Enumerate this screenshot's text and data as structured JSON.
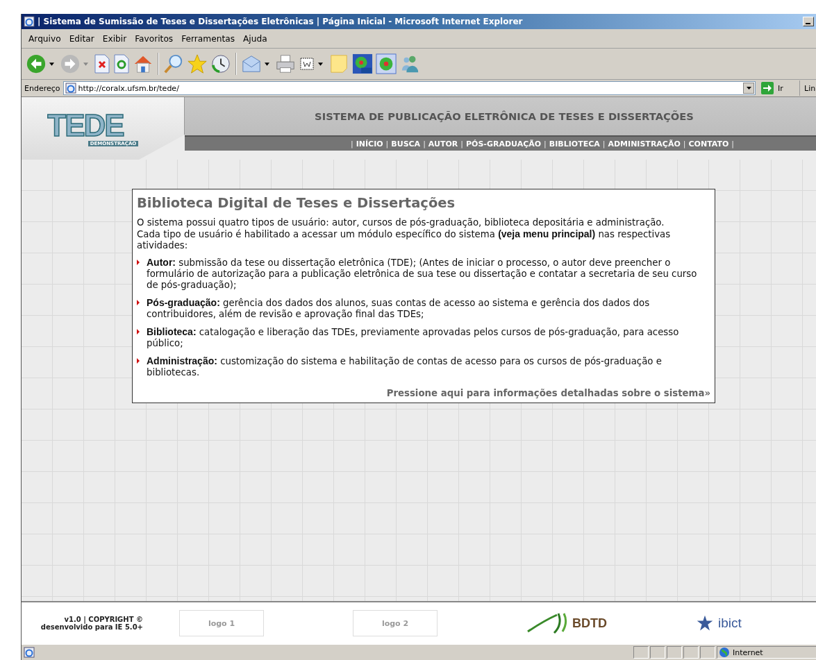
{
  "window": {
    "title": "| Sistema de Sumissão de Teses e Dissertações Eletrônicas | Página Inicial - Microsoft Internet Explorer"
  },
  "menu_bar": [
    "Arquivo",
    "Editar",
    "Exibir",
    "Favoritos",
    "Ferramentas",
    "Ajuda"
  ],
  "address_bar": {
    "label": "Endereço",
    "url": "http://coralx.ufsm.br/tede/",
    "go_button": "Ir",
    "links": "Lin"
  },
  "site_header": {
    "logo_text": "TEDE",
    "logo_subtitle": "DEMONSTRAÇÃO",
    "title": "SISTEMA DE PUBLICAÇÃO ELETRÔNICA DE TESES E DISSERTAÇÕES",
    "nav": [
      {
        "kind": "separator",
        "text": "|"
      },
      {
        "kind": "link",
        "text": "INÍCIO"
      },
      {
        "kind": "separator",
        "text": "|"
      },
      {
        "kind": "link",
        "text": "BUSCA"
      },
      {
        "kind": "separator",
        "text": "|"
      },
      {
        "kind": "link",
        "text": "AUTOR"
      },
      {
        "kind": "separator",
        "text": "|"
      },
      {
        "kind": "link",
        "text": "PÓS-GRADUAÇÃO"
      },
      {
        "kind": "separator",
        "text": "|"
      },
      {
        "kind": "link",
        "text": "BIBLIOTECA"
      },
      {
        "kind": "separator",
        "text": "|"
      },
      {
        "kind": "link",
        "text": "ADMINISTRAÇÃO"
      },
      {
        "kind": "separator",
        "text": "|"
      },
      {
        "kind": "link",
        "text": "CONTATO"
      },
      {
        "kind": "separator",
        "text": "|"
      }
    ]
  },
  "article": {
    "title": "Biblioteca Digital de Teses e Dissertações",
    "paragraphs": [
      "O sistema possui quatro tipos de usuário: autor, cursos de pós-graduação, biblioteca depositária e administração.",
      "Cada tipo de usuário é habilitado a acessar um módulo específico do sistema **(veja menu principal)** nas respectivas atividades:"
    ],
    "items": [
      "**Autor:** submissão da tese ou dissertação eletrônica (TDE); (Antes de iniciar o processo, o autor deve preencher o formulário de autorização para a publicação eletrônica de sua tese ou dissertação e contatar a secretaria de seu curso de pós-graduação);",
      "**Pós-graduação:** gerência dos dados dos alunos, suas contas de acesso ao sistema e gerência dos dados dos contribuidores, além de revisão e aprovação final das TDEs;",
      "**Biblioteca:** catalogação e liberação das TDEs, previamente aprovadas pelos cursos de pós-graduação, para acesso público;",
      "**Administração:** customização do sistema e habilitação de contas de acesso para os cursos de pós-graduação e bibliotecas."
    ],
    "more_link": "Pressione aqui para informações detalhadas sobre o sistema»"
  },
  "footer": {
    "copyright": [
      "v1.0 | COPYRIGHT ©",
      "desenvolvido para IE 5.0+"
    ],
    "logo_slots": [
      "logo 1",
      "logo 2"
    ],
    "partners": [
      "BDTD",
      "ibict"
    ]
  },
  "status_bar": {
    "zone": "Internet"
  }
}
